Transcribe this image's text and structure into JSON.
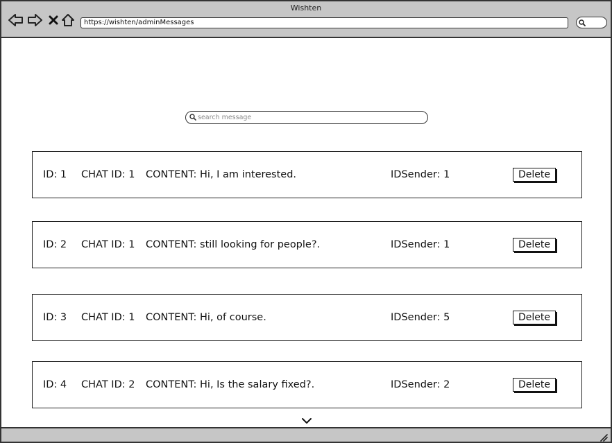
{
  "window": {
    "title": "Wishten"
  },
  "browser": {
    "url": "https://wishten/adminMessages",
    "icons": [
      "back-arrow-icon",
      "forward-arrow-icon",
      "stop-icon",
      "home-icon",
      "search-icon"
    ]
  },
  "search": {
    "placeholder": "search message",
    "value": ""
  },
  "messages": [
    {
      "id": "ID: 1",
      "chat": "CHAT ID: 1",
      "content": "CONTENT: Hi, I am interested.",
      "sender": "IDSender: 1",
      "action": "Delete"
    },
    {
      "id": "ID: 2",
      "chat": "CHAT ID: 1",
      "content": "CONTENT: still looking for people?.",
      "sender": "IDSender: 1",
      "action": "Delete"
    },
    {
      "id": "ID: 3",
      "chat": "CHAT ID: 1",
      "content": "CONTENT: Hi, of course.",
      "sender": "IDSender: 5",
      "action": "Delete"
    },
    {
      "id": "ID: 4",
      "chat": "CHAT ID: 2",
      "content": "CONTENT: Hi, Is the salary fixed?.",
      "sender": "IDSender: 2",
      "action": "Delete"
    }
  ],
  "colors": {
    "chrome": "#c6c6c6",
    "border": "#333333",
    "text": "#111111"
  }
}
